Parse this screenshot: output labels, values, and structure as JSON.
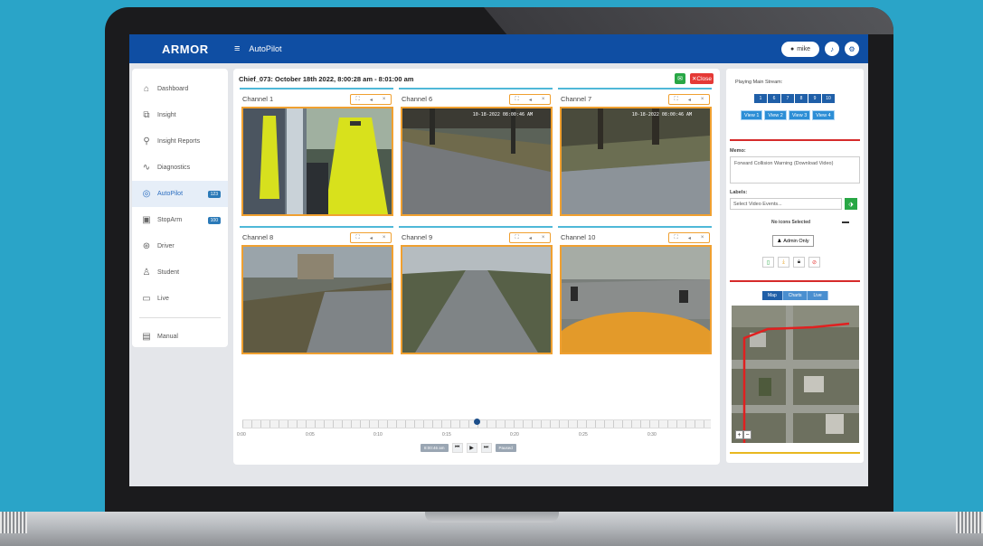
{
  "app": {
    "brand": "ARMOR",
    "title": "AutoPilot",
    "user_name": "mike"
  },
  "sidebar": {
    "items": [
      {
        "label": "Dashboard",
        "icon": "home-icon",
        "glyph": "⌂",
        "badge": ""
      },
      {
        "label": "Insight",
        "icon": "network-icon",
        "glyph": "⧉",
        "badge": ""
      },
      {
        "label": "Insight Reports",
        "icon": "search-icon",
        "glyph": "⚲",
        "badge": ""
      },
      {
        "label": "Diagnostics",
        "icon": "pulse-icon",
        "glyph": "∿",
        "badge": ""
      },
      {
        "label": "AutoPilot",
        "icon": "autopilot-icon",
        "glyph": "◎",
        "badge": "123"
      },
      {
        "label": "StopArm",
        "icon": "bus-icon",
        "glyph": "▣",
        "badge": "100"
      },
      {
        "label": "Driver",
        "icon": "steering-wheel-icon",
        "glyph": "⊛",
        "badge": ""
      },
      {
        "label": "Student",
        "icon": "student-icon",
        "glyph": "♙",
        "badge": ""
      },
      {
        "label": "Live",
        "icon": "video-icon",
        "glyph": "▭",
        "badge": ""
      }
    ],
    "manual_label": "Manual"
  },
  "main": {
    "event_title": "Chief_073: October 18th 2022, 8:00:28 am - 8:01:00 am",
    "close_label": "Close",
    "channels": [
      {
        "name": "Channel 1",
        "timestamp": ""
      },
      {
        "name": "Channel 6",
        "timestamp": "10-18-2022  08:00:46 AM"
      },
      {
        "name": "Channel 7",
        "timestamp": "10-18-2022  08:00:46 AM"
      },
      {
        "name": "Channel 8",
        "timestamp": ""
      },
      {
        "name": "Channel 9",
        "timestamp": ""
      },
      {
        "name": "Channel 10",
        "timestamp": ""
      }
    ],
    "timeline": {
      "ticks": [
        "0:00",
        "0:05",
        "0:10",
        "0:15",
        "0:20",
        "0:25",
        "0:30"
      ],
      "position_fraction": 0.5,
      "current_time": "8:00:46 am",
      "status": "Paused"
    }
  },
  "right_panel": {
    "stream_label": "Playing Main Stream:",
    "streams": [
      "1",
      "6",
      "7",
      "8",
      "9",
      "10"
    ],
    "views": [
      "View 1",
      "View 2",
      "View 3",
      "View 4"
    ],
    "memo_label": "Memo:",
    "memo_value": "Forward Collision Warning (Download Video)",
    "labels_label": "Labels:",
    "labels_placeholder": "Select Video Events...",
    "icons_selected": "No icons Selected",
    "admin_label": "Admin Only",
    "map_tabs": [
      "Map",
      "Charts",
      "Live"
    ]
  },
  "colors": {
    "brand_blue": "#0f4ea3",
    "accent_orange": "#f0a030",
    "close_red": "#e53935",
    "success_green": "#28a745"
  }
}
